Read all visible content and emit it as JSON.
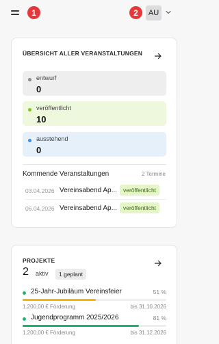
{
  "header": {
    "badge_1": "1",
    "badge_2": "2",
    "avatar_initials": "AU"
  },
  "events_card": {
    "title": "ÜBERSICHT ALLER VERANSTALTUNGEN",
    "stats": [
      {
        "label": "entwurf",
        "value": "0",
        "dot_color": "#8c8c8c"
      },
      {
        "label": "veröffentlicht",
        "value": "10",
        "dot_color": "#7cc522"
      },
      {
        "label": "ausstehend",
        "value": "0",
        "dot_color": "#3b8fe0"
      }
    ],
    "upcoming_title": "Kommende Veranstaltungen",
    "upcoming_count": "2 Termine",
    "upcoming": [
      {
        "date": "03.04.2026",
        "name": "Vereinsabend Ap...",
        "status": "veröffentlicht"
      },
      {
        "date": "06.04.2026",
        "name": "Vereinsabend Ap...",
        "status": "veröffentlicht"
      }
    ]
  },
  "projects_card": {
    "title": "PROJEKTE",
    "active_count": "2",
    "active_label": "aktiv",
    "planned_badge": "1 geplant",
    "items": [
      {
        "name": "25-Jahr-Jubiläum Vereinsfeier",
        "percent": "51 %",
        "progress": 0.51,
        "bar_color": "#f5b400",
        "funding": "1.200,00 € Förderung",
        "due": "bis 31.10.2026"
      },
      {
        "name": "Jugendprogramm 2025/2026",
        "percent": "81 %",
        "progress": 0.81,
        "bar_color": "#19b36b",
        "funding": "1.200,00 € Förderung",
        "due": "bis 31.12.2026"
      }
    ]
  }
}
